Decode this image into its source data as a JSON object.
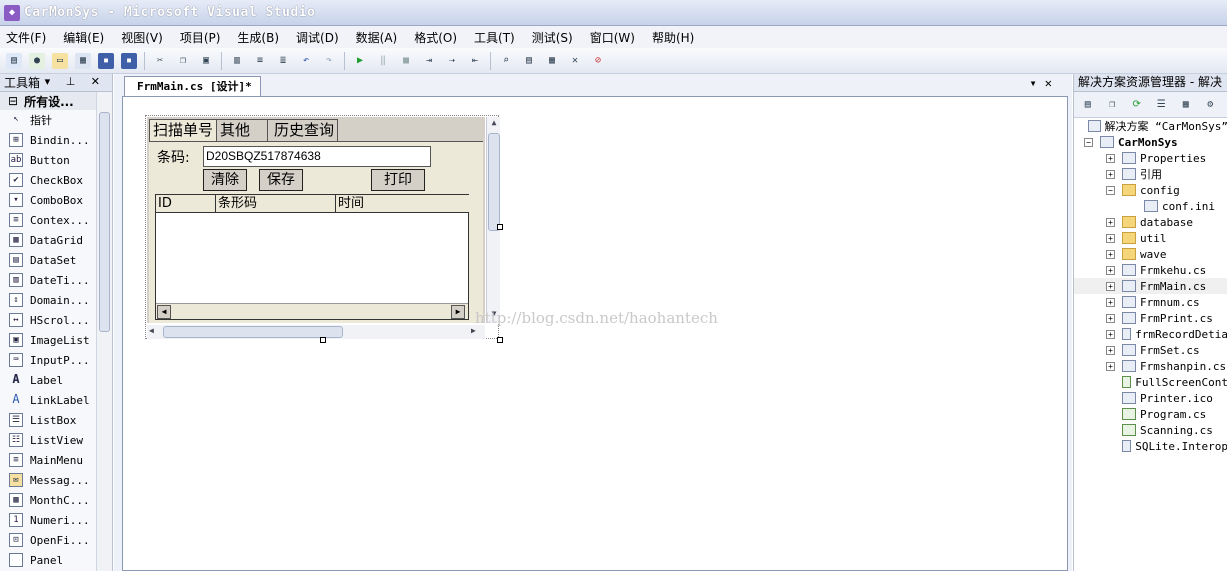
{
  "window": {
    "title": "CarMonSys - Microsoft Visual Studio"
  },
  "menu": [
    "文件(F)",
    "编辑(E)",
    "视图(V)",
    "项目(P)",
    "生成(B)",
    "调试(D)",
    "数据(A)",
    "格式(O)",
    "工具(T)",
    "测试(S)",
    "窗口(W)",
    "帮助(H)"
  ],
  "toolbox": {
    "title": "工具箱",
    "group": "所有设...",
    "items": [
      "指针",
      "Bindin...",
      "Button",
      "CheckBox",
      "ComboBox",
      "Contex...",
      "DataGrid",
      "DataSet",
      "DateTi...",
      "Domain...",
      "HScrol...",
      "ImageList",
      "InputP...",
      "Label",
      "LinkLabel",
      "ListBox",
      "ListView",
      "MainMenu",
      "Messag...",
      "MonthC...",
      "Numeri...",
      "OpenFi...",
      "Panel"
    ]
  },
  "document": {
    "tab": "FrmMain.cs [设计]*"
  },
  "form": {
    "tabs": [
      "扫描单号",
      "其他",
      "历史查询"
    ],
    "barcode_label": "条码:",
    "barcode_value": "D20SBQZ517874638",
    "buttons": {
      "clear": "清除",
      "save": "保存",
      "print": "打印"
    },
    "grid_columns": [
      "ID",
      "条形码",
      "时间"
    ]
  },
  "watermark": "http://blog.csdn.net/haohantech",
  "solution_explorer": {
    "title": "解决方案资源管理器 - 解决",
    "nodes": [
      {
        "label": "解决方案 “CarMonSys”",
        "type": "solution"
      },
      {
        "label": "CarMonSys",
        "type": "project"
      },
      {
        "label": "Properties",
        "type": "item"
      },
      {
        "label": "引用",
        "type": "item"
      },
      {
        "label": "config",
        "type": "folder"
      },
      {
        "label": "conf.ini",
        "type": "file"
      },
      {
        "label": "database",
        "type": "folder"
      },
      {
        "label": "util",
        "type": "folder"
      },
      {
        "label": "wave",
        "type": "folder"
      },
      {
        "label": "Frmkehu.cs",
        "type": "form"
      },
      {
        "label": "FrmMain.cs",
        "type": "form"
      },
      {
        "label": "Frmnum.cs",
        "type": "form"
      },
      {
        "label": "FrmPrint.cs",
        "type": "form"
      },
      {
        "label": "frmRecordDetia",
        "type": "form"
      },
      {
        "label": "FrmSet.cs",
        "type": "form"
      },
      {
        "label": "Frmshanpin.cs",
        "type": "form"
      },
      {
        "label": "FullScreenCont",
        "type": "cs"
      },
      {
        "label": "Printer.ico",
        "type": "file"
      },
      {
        "label": "Program.cs",
        "type": "cs"
      },
      {
        "label": "Scanning.cs",
        "type": "cs"
      },
      {
        "label": "SQLite.Interop",
        "type": "file"
      }
    ]
  }
}
